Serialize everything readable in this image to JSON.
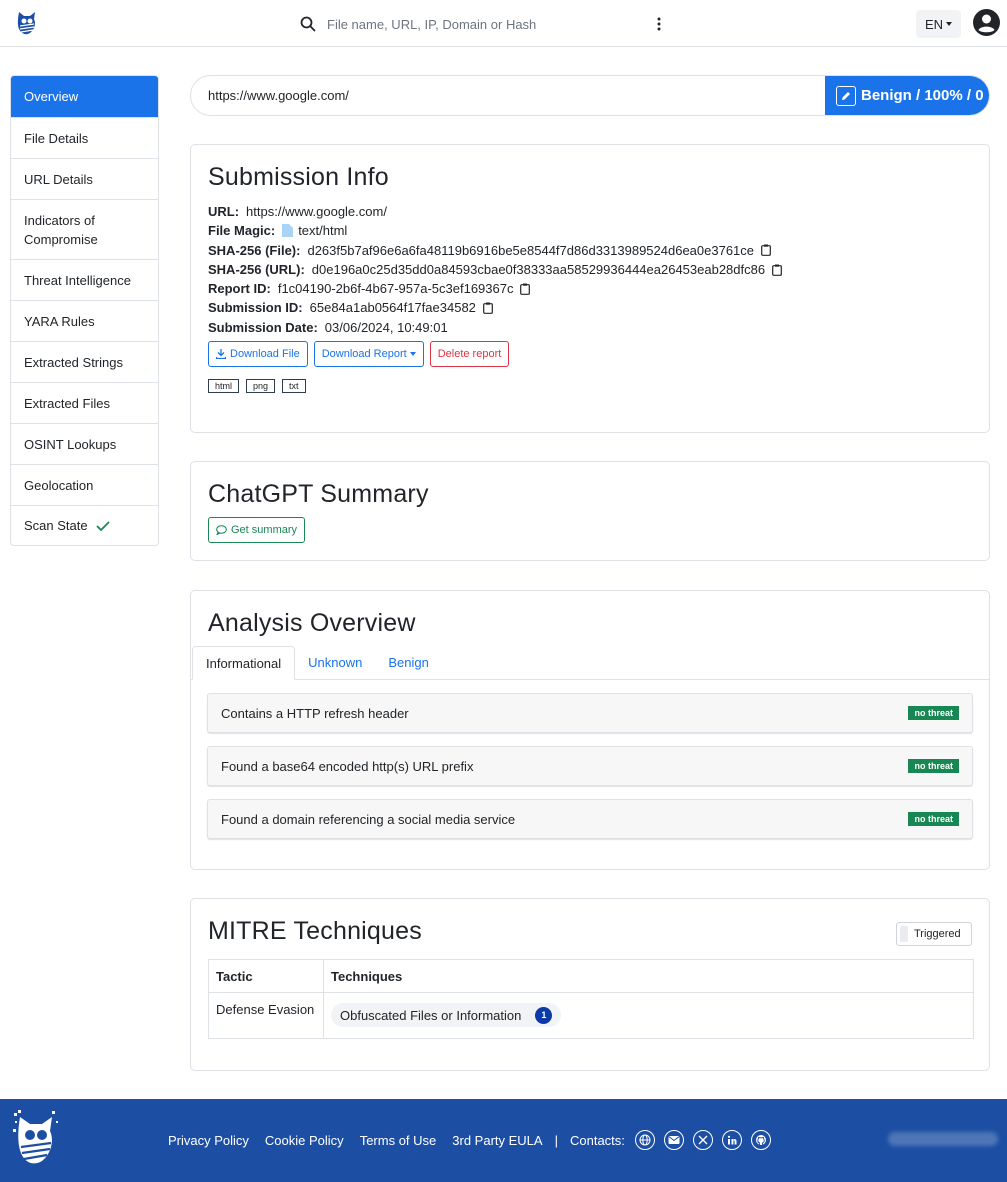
{
  "topnav": {
    "search_placeholder": "File name, URL, IP, Domain or Hash",
    "lang_label": "EN"
  },
  "sidebar": {
    "items": [
      {
        "label": "Overview",
        "active": true
      },
      {
        "label": "File Details"
      },
      {
        "label": "URL Details"
      },
      {
        "label": "Indicators of Compromise"
      },
      {
        "label": "Threat Intelligence"
      },
      {
        "label": "YARA Rules"
      },
      {
        "label": "Extracted Strings"
      },
      {
        "label": "Extracted Files"
      },
      {
        "label": "OSINT Lookups"
      },
      {
        "label": "Geolocation"
      },
      {
        "label": "Scan State"
      }
    ]
  },
  "urlbar": {
    "url": "https://www.google.com/",
    "verdict": "Benign / 100% / 0"
  },
  "submission": {
    "title": "Submission Info",
    "url_key": "URL:",
    "url_value": "https://www.google.com/",
    "magic_key": "File Magic:",
    "magic_value": "text/html",
    "sha_file_key": "SHA-256 (File):",
    "sha_file_value": "d263f5b7af96e6a6fa48119b6916be5e8544f7d86d3313989524d6ea0e3761ce",
    "sha_url_key": "SHA-256 (URL):",
    "sha_url_value": "d0e196a0c25d35dd0a84593cbae0f38333aa58529936444ea26453eab28dfc86",
    "report_key": "Report ID:",
    "report_value": "f1c04190-2b6f-4b67-957a-5c3ef169367c",
    "subid_key": "Submission ID:",
    "subid_value": "65e84a1ab0564f17fae34582",
    "date_key": "Submission Date:",
    "date_value": "03/06/2024, 10:49:01",
    "download_file": "Download File",
    "download_report": "Download Report",
    "delete_report": "Delete report",
    "tags": [
      "html",
      "png",
      "txt"
    ]
  },
  "chatgpt": {
    "title": "ChatGPT Summary",
    "button": "Get summary"
  },
  "analysis": {
    "title": "Analysis Overview",
    "tabs": [
      "Informational",
      "Unknown",
      "Benign"
    ],
    "signatures": [
      {
        "text": "Contains a HTTP refresh header",
        "badge": "no threat"
      },
      {
        "text": "Found a base64 encoded http(s) URL prefix",
        "badge": "no threat"
      },
      {
        "text": "Found a domain referencing a social media service",
        "badge": "no threat"
      }
    ]
  },
  "mitre": {
    "title": "MITRE Techniques",
    "toggle": "Triggered",
    "col_tactic": "Tactic",
    "col_techniques": "Techniques",
    "rows": [
      {
        "tactic": "Defense Evasion",
        "technique": "Obfuscated Files or Information",
        "count": "1"
      }
    ]
  },
  "footer": {
    "links": [
      "Privacy Policy",
      "Cookie Policy",
      "Terms of Use",
      "3rd Party EULA"
    ],
    "separator": "|",
    "contacts": "Contacts:",
    "social_icons": [
      "globe-icon",
      "mail-icon",
      "x-icon",
      "linkedin-icon",
      "github-icon"
    ]
  },
  "colors": {
    "primary": "#1a73e8",
    "footer_bg": "#1c4fa3",
    "success": "#198754",
    "danger": "#dc3545"
  }
}
